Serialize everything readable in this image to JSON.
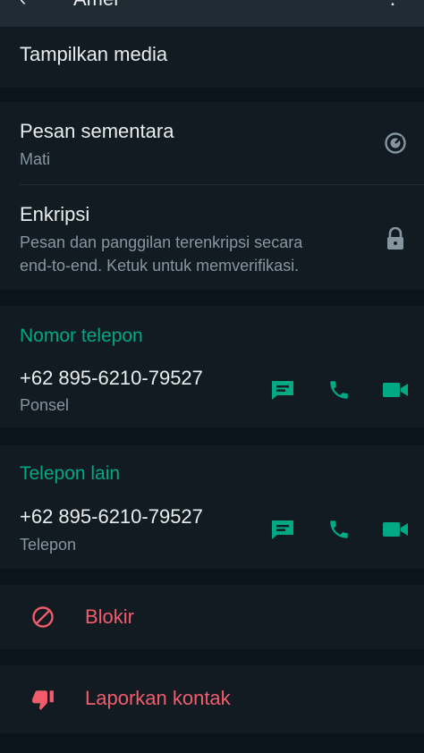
{
  "header": {
    "title": "Amer"
  },
  "media": {
    "label": "Tampilkan media"
  },
  "disappearing": {
    "title": "Pesan sementara",
    "value": "Mati"
  },
  "encryption": {
    "title": "Enkripsi",
    "line1": "Pesan dan panggilan terenkripsi secara",
    "line2": "end-to-end. Ketuk untuk memverifikasi."
  },
  "phone_primary": {
    "header": "Nomor telepon",
    "number": "+62 895-6210-79527",
    "type": "Ponsel"
  },
  "phone_other": {
    "header": "Telepon lain",
    "number": "+62 895-6210-79527",
    "type": "Telepon"
  },
  "actions": {
    "block": "Blokir",
    "report": "Laporkan kontak"
  },
  "colors": {
    "accent": "#00a884",
    "danger": "#f15c6d",
    "background": "#0b141a",
    "card": "#111b21"
  },
  "icons": [
    "back-arrow-icon",
    "overflow-menu-icon",
    "timer-icon",
    "lock-icon",
    "message-icon",
    "phone-icon",
    "video-icon",
    "block-icon",
    "thumbs-down-icon"
  ]
}
